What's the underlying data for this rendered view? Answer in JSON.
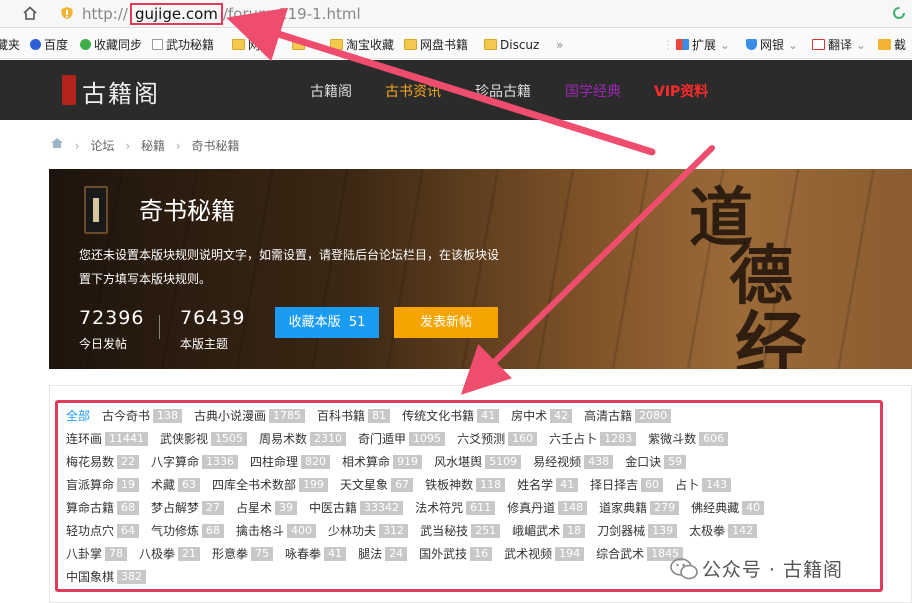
{
  "browser": {
    "url_prefix": "http://",
    "url_domain": "gujige.com",
    "url_path": "/forum-119-1.html"
  },
  "bookmarks": [
    {
      "label": "藏夹",
      "icon": "none"
    },
    {
      "label": "百度",
      "icon": "baidu-paw-icon"
    },
    {
      "label": "收藏同步",
      "icon": "sync-leaf-icon"
    },
    {
      "label": "武功秘籍",
      "icon": "page-icon"
    },
    {
      "label": "网",
      "icon": "folder-icon"
    },
    {
      "label": "",
      "icon": "folder-icon"
    },
    {
      "label": "淘宝收藏",
      "icon": "folder-icon"
    },
    {
      "label": "网盘书籍",
      "icon": "folder-icon"
    },
    {
      "label": "Discuz",
      "icon": "folder-icon"
    },
    {
      "label": "»",
      "icon": "none"
    }
  ],
  "toolbar_right": [
    {
      "label": "扩展",
      "icon": "grid-icon"
    },
    {
      "label": "网银",
      "icon": "shield-icon"
    },
    {
      "label": "翻译",
      "icon": "translate-icon"
    },
    {
      "label": "截",
      "icon": "scissors-icon"
    }
  ],
  "site": {
    "logo": "古籍阁",
    "nav": [
      "古籍阁",
      "古书资讯",
      "珍品古籍",
      "国学经典",
      "VIP资料"
    ],
    "nav_colors": [
      "#dddddd",
      "#f5a623",
      "#dddddd",
      "#9b27b0",
      "#ff2b2b"
    ]
  },
  "breadcrumb": [
    "论坛",
    "秘籍",
    "奇书秘籍"
  ],
  "forum": {
    "title": "奇书秘籍",
    "description": "您还未设置本版块规则说明文字，如需设置，请登陆后台论坛栏目，在该板块设置下方填写本版块规则。",
    "today_posts": "72396",
    "today_posts_label": "今日发帖",
    "topics": "76439",
    "topics_label": "本版主题",
    "fav_button": "收藏本版",
    "fav_count": "51",
    "post_button": "发表新帖",
    "calligraphy": [
      "道",
      "德",
      "经"
    ]
  },
  "categories": [
    [
      {
        "n": "全部",
        "c": "",
        "active": true
      },
      {
        "n": "古今奇书",
        "c": "138"
      },
      {
        "n": "古典小说漫画",
        "c": "1785"
      },
      {
        "n": "百科书籍",
        "c": "81"
      },
      {
        "n": "传统文化书籍",
        "c": "41"
      },
      {
        "n": "房中术",
        "c": "42"
      },
      {
        "n": "高清古籍",
        "c": "2080"
      }
    ],
    [
      {
        "n": "连环画",
        "c": "11441"
      },
      {
        "n": "武侠影视",
        "c": "1505"
      },
      {
        "n": "周易术数",
        "c": "2310"
      },
      {
        "n": "奇门遁甲",
        "c": "1095"
      },
      {
        "n": "六爻预测",
        "c": "160"
      },
      {
        "n": "六壬占卜",
        "c": "1283"
      },
      {
        "n": "紫微斗数",
        "c": "606"
      }
    ],
    [
      {
        "n": "梅花易数",
        "c": "22"
      },
      {
        "n": "八字算命",
        "c": "1336"
      },
      {
        "n": "四柱命理",
        "c": "820"
      },
      {
        "n": "相术算命",
        "c": "919"
      },
      {
        "n": "风水堪舆",
        "c": "5109"
      },
      {
        "n": "易经视频",
        "c": "438"
      },
      {
        "n": "金口诀",
        "c": "59"
      }
    ],
    [
      {
        "n": "盲派算命",
        "c": "19"
      },
      {
        "n": "术藏",
        "c": "63"
      },
      {
        "n": "四库全书术数部",
        "c": "199"
      },
      {
        "n": "天文星象",
        "c": "67"
      },
      {
        "n": "铁板神数",
        "c": "118"
      },
      {
        "n": "姓名学",
        "c": "41"
      },
      {
        "n": "择日择吉",
        "c": "60"
      },
      {
        "n": "占卜",
        "c": "143"
      }
    ],
    [
      {
        "n": "算命古籍",
        "c": "68"
      },
      {
        "n": "梦占解梦",
        "c": "27"
      },
      {
        "n": "占星术",
        "c": "39"
      },
      {
        "n": "中医古籍",
        "c": "33342"
      },
      {
        "n": "法术符咒",
        "c": "611"
      },
      {
        "n": "修真丹道",
        "c": "148"
      },
      {
        "n": "道家典籍",
        "c": "279"
      },
      {
        "n": "佛经典藏",
        "c": "40"
      }
    ],
    [
      {
        "n": "轻功点穴",
        "c": "64"
      },
      {
        "n": "气功修炼",
        "c": "68"
      },
      {
        "n": "擒击格斗",
        "c": "400"
      },
      {
        "n": "少林功夫",
        "c": "312"
      },
      {
        "n": "武当秘技",
        "c": "251"
      },
      {
        "n": "峨嵋武术",
        "c": "18"
      },
      {
        "n": "刀剑器械",
        "c": "139"
      },
      {
        "n": "太极拳",
        "c": "142"
      }
    ],
    [
      {
        "n": "八卦掌",
        "c": "78"
      },
      {
        "n": "八极拳",
        "c": "21"
      },
      {
        "n": "形意拳",
        "c": "75"
      },
      {
        "n": "咏春拳",
        "c": "41"
      },
      {
        "n": "腿法",
        "c": "24"
      },
      {
        "n": "国外武技",
        "c": "16"
      },
      {
        "n": "武术视频",
        "c": "194"
      },
      {
        "n": "综合武术",
        "c": "1845"
      }
    ],
    [
      {
        "n": "中国象棋",
        "c": "382"
      }
    ]
  ],
  "watermark": "公众号 · 古籍阁"
}
